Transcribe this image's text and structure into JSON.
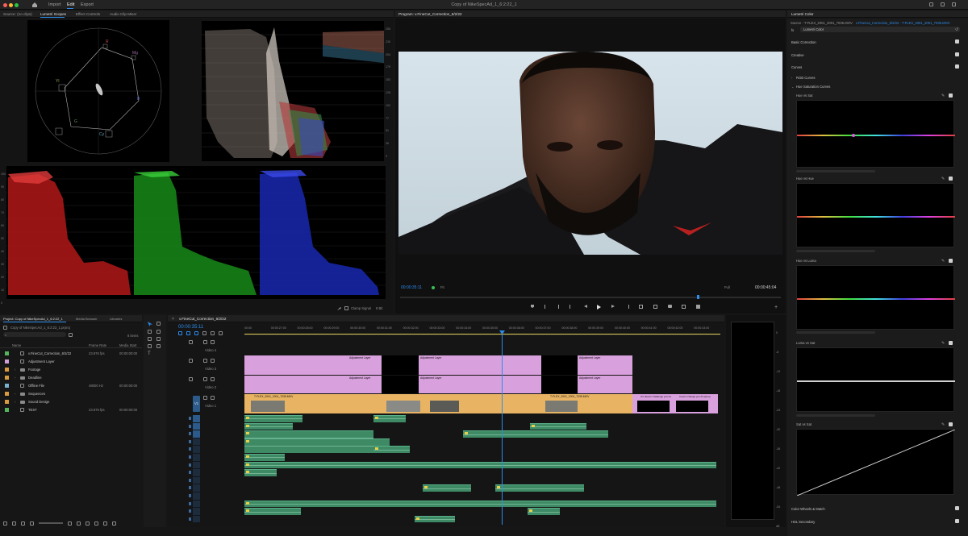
{
  "window": {
    "title": "Copy of NikeSpecAd_1_6:2:22_1",
    "nav": [
      "Import",
      "Edit",
      "Export"
    ],
    "active_nav": "Edit"
  },
  "colors": {
    "accent": "#2d8ceb",
    "adjust_clip": "#d8a0dc",
    "video_clip": "#e8b464",
    "audio_clip": "#3d8a65",
    "playhead": "#2d8ceb"
  },
  "source_panel": {
    "tabs": [
      "Source: (no clips)",
      "Lumetri Scopes",
      "Effect Controls",
      "Audio Clip Mixer"
    ],
    "active_tab": "Lumetri Scopes",
    "vectorscope_labels": [
      "R",
      "Mg",
      "B",
      "Cy",
      "G",
      "Yl"
    ],
    "waveform_ticks_right": [
      "255",
      "230",
      "204",
      "179",
      "153",
      "128",
      "102",
      "77",
      "51",
      "26",
      "0"
    ],
    "waveform_ticks_left": [
      "100",
      "90",
      "80",
      "70",
      "60",
      "50",
      "40",
      "30",
      "20",
      "10",
      "0"
    ],
    "footer_option": "Clamp Signal",
    "footer_bits": "8 Bit"
  },
  "program_panel": {
    "title": "Program: v.FineCut_Correction_6/2/22",
    "timecode": "00:00:35:11",
    "fit": "Fit",
    "quality": "Full",
    "duration": "00:00:45:04"
  },
  "lumetri": {
    "title": "Lumetri Color",
    "source": "Source - T-FLEX_2001_2001_7035.MOV",
    "clip": "v.FineCut_Correction_6/2/22 - T-FLEX_2001_2001_7035.MOV",
    "fx": "fx",
    "fx_label": "Lumetri Color",
    "sections": [
      "Basic Correction",
      "Creative",
      "Curves"
    ],
    "subsections": [
      "RGB Curves",
      "Hue Saturation Curves"
    ],
    "curves": [
      "Hue vs Sat",
      "Hue vs Hue",
      "Hue vs Luma",
      "Luma vs Sat",
      "Sat vs Sat"
    ],
    "bottom": [
      "Color Wheels & Match",
      "HSL Secondary"
    ]
  },
  "project": {
    "tabs": [
      "Project: Copy of NikeSpecAd_1_6:2:22_1",
      "Media Browser",
      "Libraries"
    ],
    "active_tab": "Project: Copy of NikeSpecAd_1_6:2:22_1",
    "path": "Copy of NikeSpecAd_1_6:2:22_1.prproj",
    "count": "8 items",
    "columns": [
      "Name",
      "Frame Rate",
      "Media Start"
    ],
    "items": [
      {
        "name": "v.FineCut_Correction_6/2/22",
        "rate": "23.976 fps",
        "start": "00:00:00:00",
        "color": "#55b55c"
      },
      {
        "name": "Adjustment Layer",
        "rate": "",
        "start": "",
        "color": "#cfa0d8"
      },
      {
        "name": "Footage",
        "rate": "",
        "start": "",
        "color": "#d89a3c"
      },
      {
        "name": "Deadline",
        "rate": "",
        "start": "",
        "color": "#d89a3c"
      },
      {
        "name": "Offline File",
        "rate": "48000 Hz",
        "start": "00:00:00:00",
        "color": "#7bb0d0"
      },
      {
        "name": "Sequences",
        "rate": "",
        "start": "",
        "color": "#d89a3c"
      },
      {
        "name": "Sound Design",
        "rate": "",
        "start": "",
        "color": "#d89a3c"
      },
      {
        "name": "TEST",
        "rate": "23.976 fps",
        "start": "00:00:00:00",
        "color": "#55b55c"
      }
    ]
  },
  "timeline": {
    "tab": "v.FineCut_Correction_6/2/22",
    "timecode": "00:00:35:11",
    "ruler": [
      "00:00",
      "00:00:27:00",
      "00:00:28:00",
      "00:00:29:00",
      "00:00:30:00",
      "00:00:31:00",
      "00:00:32:00",
      "00:00:33:00",
      "00:00:34:00",
      "00:00:35:00",
      "00:00:36:00",
      "00:00:37:00",
      "00:00:38:00",
      "00:00:39:00",
      "00:00:40:00",
      "00:00:41:00",
      "00:00:42:00",
      "00:00:43:00"
    ],
    "tracks": [
      "Video 4",
      "Video 3",
      "Video 2",
      "Video 1"
    ],
    "v1": "V1",
    "adjust_label": "Adjustment Layer",
    "clip_label": "T-FLEX_2001_2001_7035.MOV",
    "text1": "If it doesn't challenge you it's",
    "text2": "It won't change you 01.prproj",
    "tc_label": "00:00:05:00"
  },
  "meter": {
    "ticks": [
      "0",
      "-6",
      "-12",
      "-18",
      "-24",
      "-30",
      "-36",
      "-42",
      "-48",
      "-54",
      "dB"
    ]
  }
}
